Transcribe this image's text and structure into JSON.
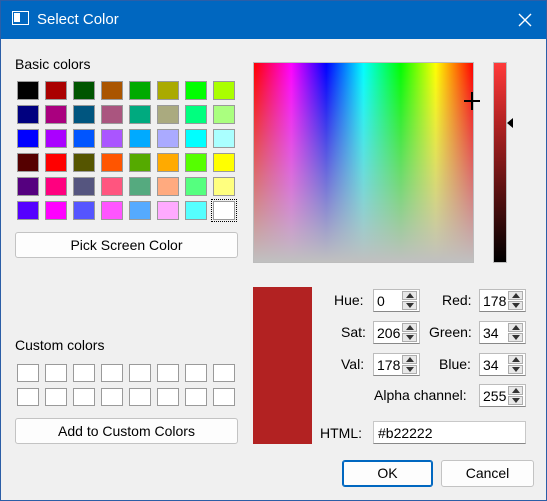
{
  "window": {
    "title": "Select Color"
  },
  "basic": {
    "label": "Basic colors",
    "swatches": [
      "#000000",
      "#aa0000",
      "#005500",
      "#aa5500",
      "#00aa00",
      "#aaaa00",
      "#00ff00",
      "#aaff00",
      "#00007f",
      "#aa007f",
      "#00557f",
      "#aa557f",
      "#00aa7f",
      "#aaaa7f",
      "#00ff7f",
      "#aaff7f",
      "#0000ff",
      "#aa00ff",
      "#0055ff",
      "#aa55ff",
      "#00aaff",
      "#aaaaff",
      "#00ffff",
      "#aaffff",
      "#550000",
      "#ff0000",
      "#555500",
      "#ff5500",
      "#55aa00",
      "#ffaa00",
      "#55ff00",
      "#ffff00",
      "#55007f",
      "#ff007f",
      "#55557f",
      "#ff557f",
      "#55aa7f",
      "#ffaa7f",
      "#55ff7f",
      "#ffff7f",
      "#5500ff",
      "#ff00ff",
      "#5555ff",
      "#ff55ff",
      "#55aaff",
      "#ffaaff",
      "#55ffff",
      "#ffffff"
    ],
    "selected_index": 47
  },
  "buttons": {
    "pick_screen": "Pick Screen Color",
    "add_custom": "Add to Custom Colors",
    "ok": "OK",
    "cancel": "Cancel"
  },
  "custom": {
    "label": "Custom colors",
    "count": 16
  },
  "current_color": "#b22222",
  "fields": {
    "hue_label": "Hue:",
    "hue": "0",
    "sat_label": "Sat:",
    "sat": "206",
    "val_label": "Val:",
    "val": "178",
    "red_label": "Red:",
    "red": "178",
    "green_label": "Green:",
    "green": "34",
    "blue_label": "Blue:",
    "blue": "34",
    "alpha_label": "Alpha channel:",
    "alpha": "255",
    "html_label": "HTML:",
    "html": "#b22222"
  },
  "icons": {
    "title": "window-icon",
    "close": "close-icon"
  }
}
